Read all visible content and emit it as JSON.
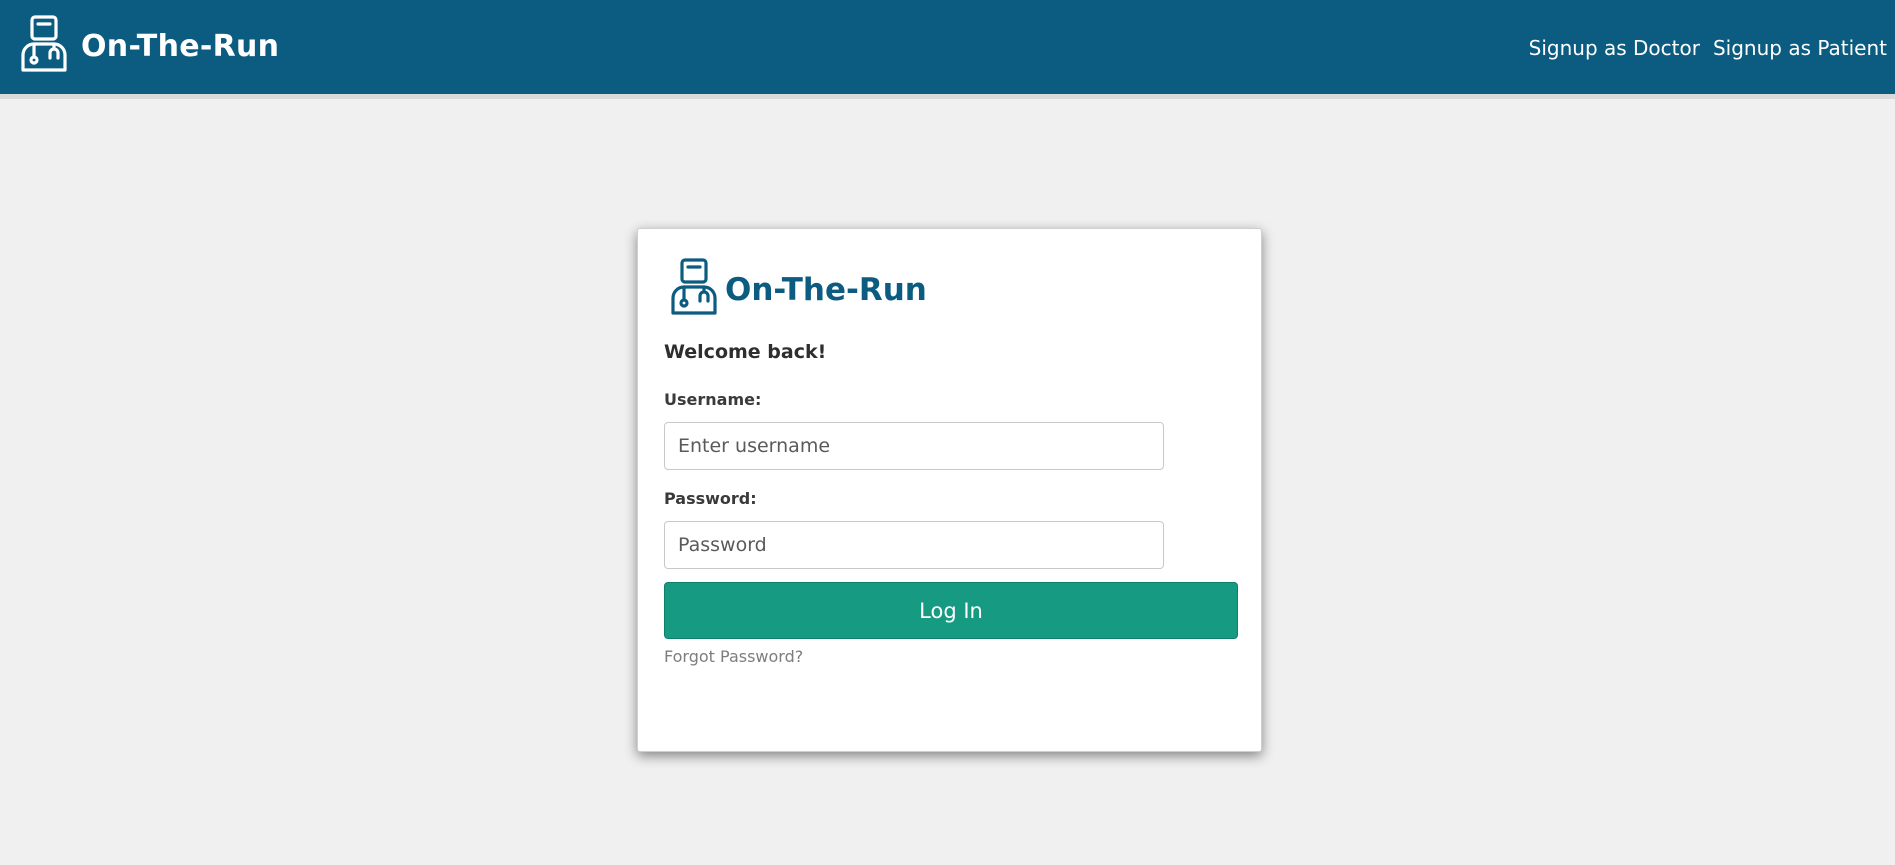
{
  "colors": {
    "navbar": "#0b5c80",
    "brand_text_card": "#0b5c80",
    "login_button": "#179a82",
    "page_bg": "#f0f0f0"
  },
  "header": {
    "brand": "On-The-Run",
    "logo_icon": "doctor-icon",
    "links": [
      "Signup as Doctor",
      "Signup as Patient"
    ]
  },
  "login_card": {
    "brand": "On-The-Run",
    "logo_icon": "doctor-icon",
    "welcome": "Welcome back!",
    "username_label": "Username:",
    "username_placeholder": "Enter username",
    "username_value": "",
    "password_label": "Password:",
    "password_placeholder": "Password",
    "password_value": "",
    "login_button": "Log In",
    "forgot_link": "Forgot Password?"
  }
}
